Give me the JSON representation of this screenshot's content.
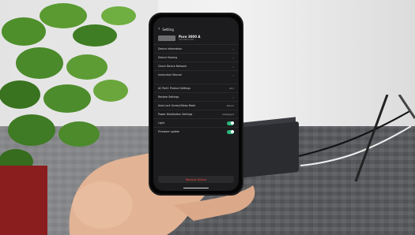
{
  "screen": {
    "title": "Setting",
    "device_name": "Pure 3000 A",
    "device_sub": "192.168.1.138",
    "rows_group1": [
      {
        "label": "Device Information",
        "value": ""
      },
      {
        "label": "Device Sharing",
        "value": ""
      },
      {
        "label": "Check Device Network",
        "value": ""
      },
      {
        "label": "Instruction Manual",
        "value": ""
      }
    ],
    "rows_group2": [
      {
        "label": "AC Port1 Product Settings",
        "value": "AC1"
      },
      {
        "label": "Restore Settings",
        "value": ""
      },
      {
        "label": "Auto Lock Screen/Sleep Mode",
        "value": "Never"
      },
      {
        "label": "Power Distribution Settings",
        "value": "Intelligent"
      },
      {
        "label": "Light",
        "value": ""
      },
      {
        "label": "Firmware update",
        "value": ""
      }
    ],
    "remove_label": "Remove Device"
  },
  "colors": {
    "accent": "#2fb67c",
    "danger": "#ff4a3d",
    "panel": "#1c1c1e"
  }
}
